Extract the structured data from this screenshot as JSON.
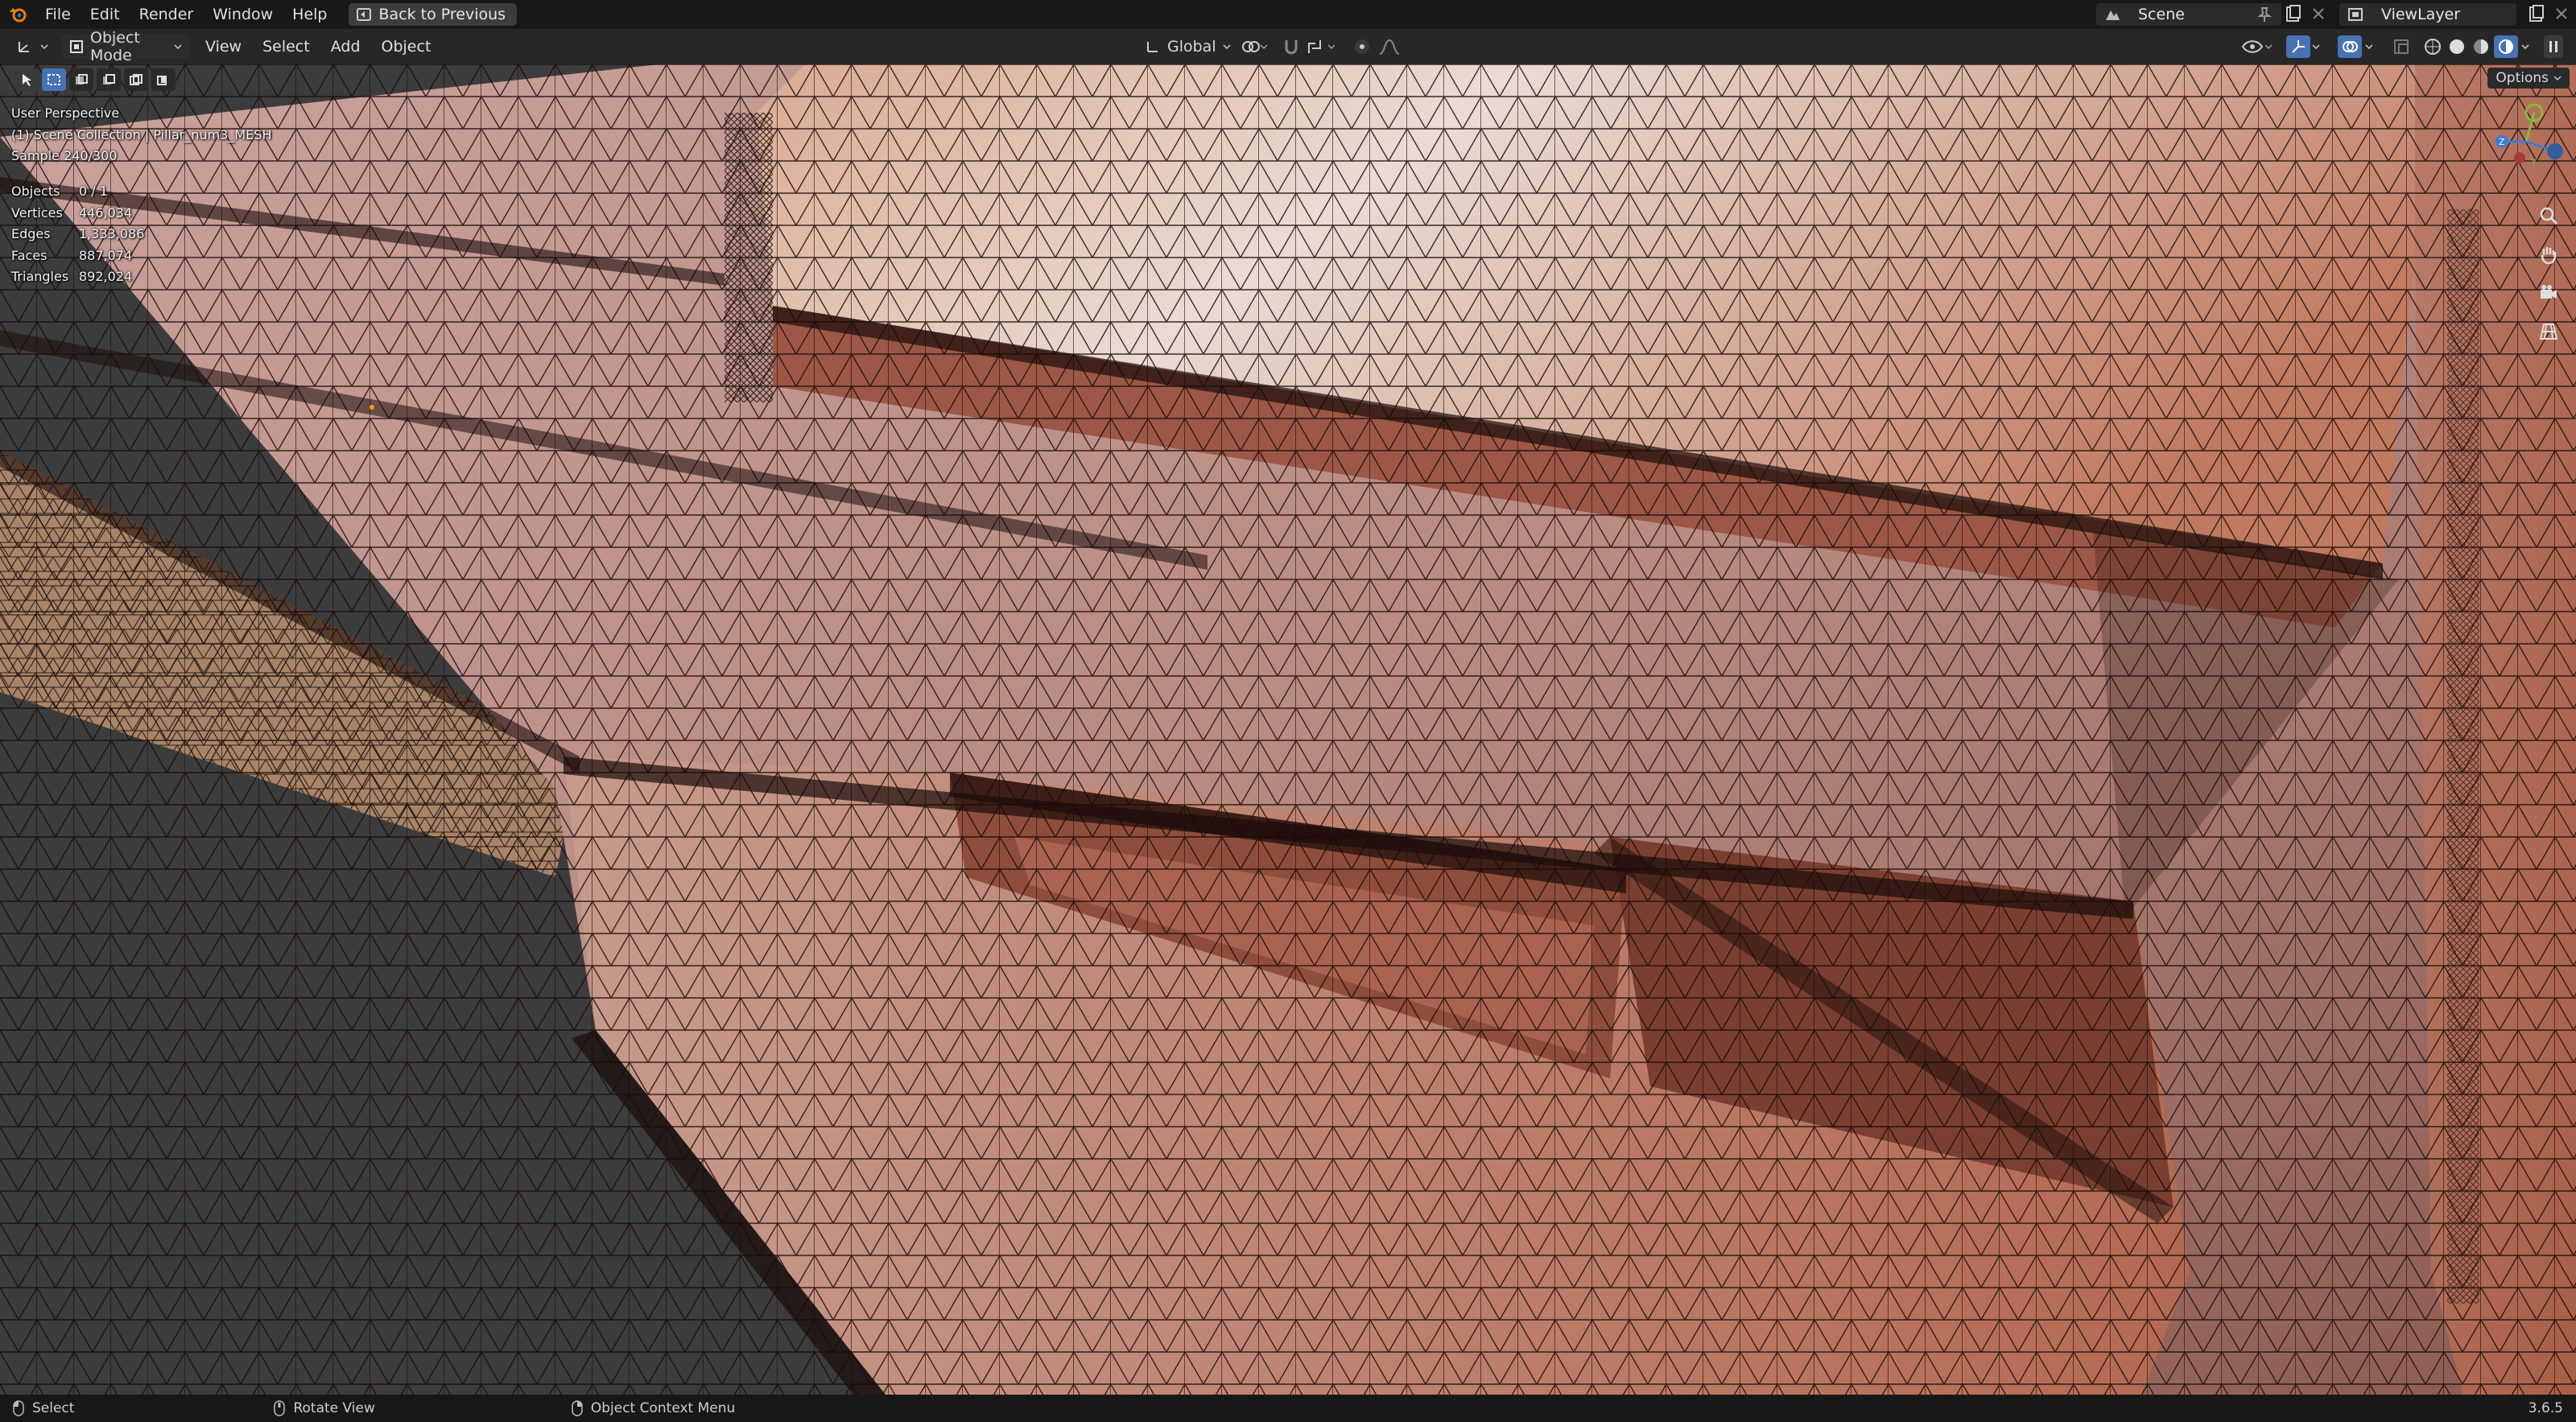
{
  "topbar": {
    "menus": [
      "File",
      "Edit",
      "Render",
      "Window",
      "Help"
    ],
    "back_label": "Back to Previous",
    "scene": "Scene",
    "view_layer": "ViewLayer"
  },
  "header": {
    "mode": "Object Mode",
    "menus": [
      "View",
      "Select",
      "Add",
      "Object"
    ],
    "orientation": "Global"
  },
  "viewport": {
    "view_name": "User Perspective",
    "collection_line": "(1) Scene Collection | Pillar_num3_MESH",
    "sample": "Sample 240/300",
    "options_label": "Options",
    "stats": [
      {
        "label": "Objects",
        "value": "0 / 1"
      },
      {
        "label": "Vertices",
        "value": "446,034"
      },
      {
        "label": "Edges",
        "value": "1,333,086"
      },
      {
        "label": "Faces",
        "value": "887,074"
      },
      {
        "label": "Triangles",
        "value": "892,024"
      }
    ],
    "gizmo_axes": [
      "X",
      "Y",
      "Z"
    ]
  },
  "statusbar": {
    "select": "Select",
    "rotate": "Rotate View",
    "context": "Object Context Menu",
    "version": "3.6.5"
  },
  "colors": {
    "accent": "#4772b3",
    "mesh": "#b46e5c"
  }
}
